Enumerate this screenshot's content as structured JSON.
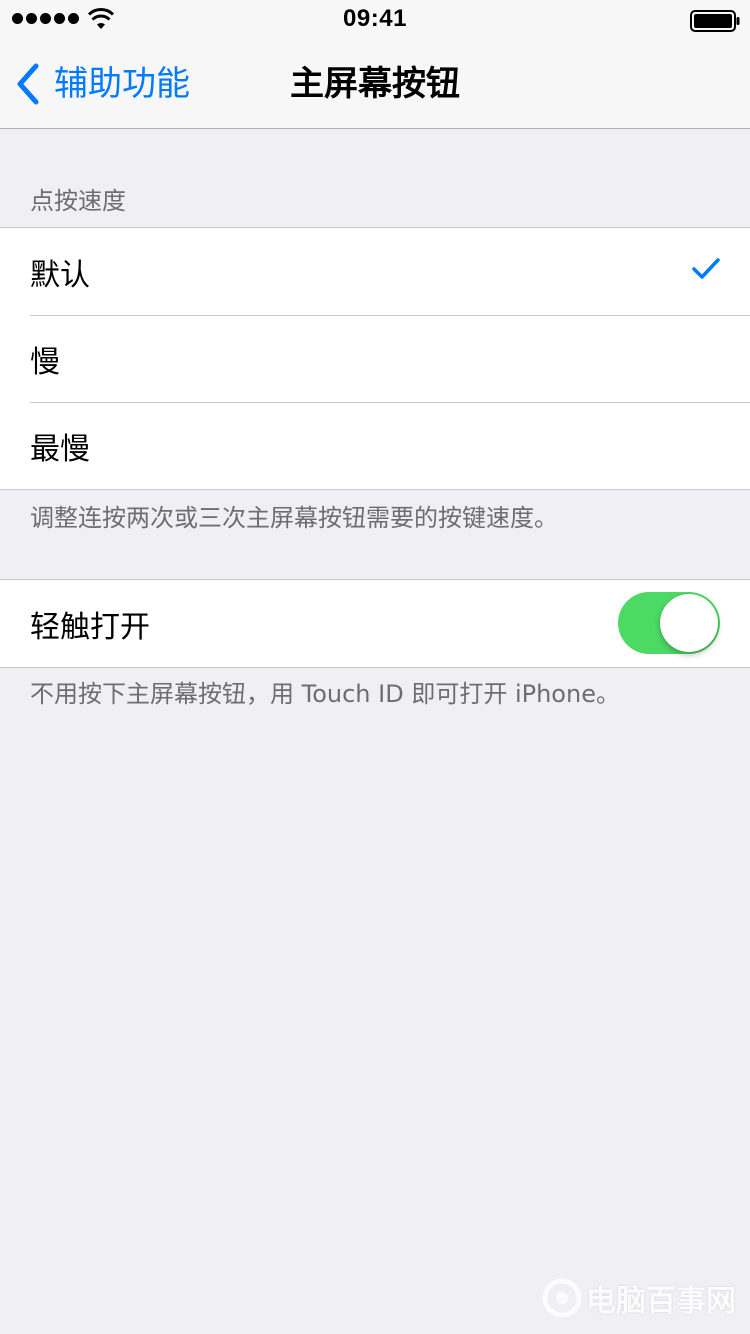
{
  "status_bar": {
    "signal_bars": 5,
    "time": "09:41",
    "icons": [
      "signal-dots-icon",
      "wifi-icon",
      "battery-icon"
    ],
    "battery_level": 1.0
  },
  "nav": {
    "back_label": "辅助功能",
    "title": "主屏幕按钮",
    "accent_color": "#007aff"
  },
  "click_speed": {
    "header": "点按速度",
    "options": [
      {
        "label": "默认",
        "selected": true
      },
      {
        "label": "慢",
        "selected": false
      },
      {
        "label": "最慢",
        "selected": false
      }
    ],
    "footer": "调整连按两次或三次主屏幕按钮需要的按键速度。"
  },
  "rest_finger": {
    "label": "轻触打开",
    "enabled": true,
    "toggle_color": "#4cd964",
    "footer": "不用按下主屏幕按钮，用 Touch ID 即可打开 iPhone。"
  },
  "watermark": {
    "text": "电脑百事网"
  }
}
